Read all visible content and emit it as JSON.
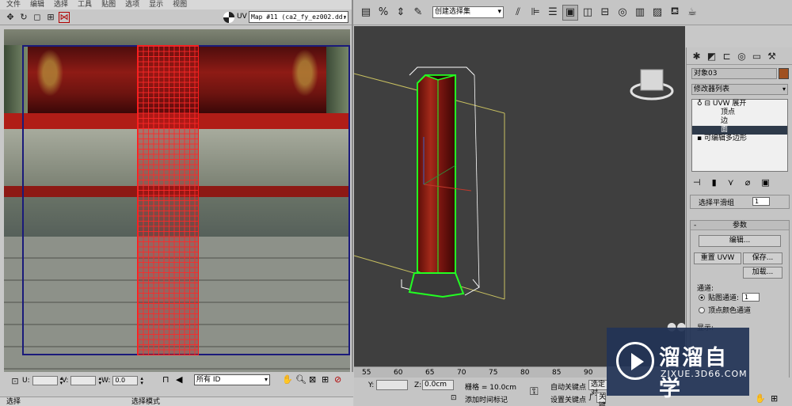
{
  "uv_editor": {
    "menu": [
      "文件",
      "编辑",
      "选择",
      "工具",
      "贴图",
      "选项",
      "显示",
      "视图"
    ],
    "toolbar_icons": [
      "move-icon",
      "rotate-icon",
      "scale-icon",
      "freeform-icon",
      "mirror-icon"
    ],
    "uv_label": "UV",
    "map_select": "Map #11 (ca2_fy_ez002.dd:",
    "coords": [
      {
        "label": "U:",
        "value": ""
      },
      {
        "label": "V:",
        "value": ""
      },
      {
        "label": "W:",
        "value": "0.0"
      }
    ],
    "id_select": "所有 ID",
    "status_left": [
      "选择",
      "选择模式"
    ]
  },
  "main_toolbar": {
    "selection_set": "创建选择集"
  },
  "command_panel": {
    "object_name": "对象03",
    "object_color": "#a05020",
    "modifier_list": "修改器列表",
    "stack": [
      {
        "label": "UVW 展开",
        "level": 0,
        "icon": "lightbulb-icon"
      },
      {
        "label": "顶点",
        "level": 1
      },
      {
        "label": "边",
        "level": 1
      },
      {
        "label": "面",
        "level": 1,
        "selected": true
      },
      {
        "label": "可编辑多边形",
        "level": 0,
        "icon": "square-icon"
      }
    ],
    "rollout_top_label": "选择平滑组",
    "rollout_top_value": "1",
    "params_title": "参数",
    "edit_button": "编辑...",
    "reset_uvw": "重置 UVW",
    "save_button": "保存...",
    "load_button": "加载...",
    "channel_group": "通道:",
    "map_channel": "贴图通道:",
    "map_channel_value": "1",
    "vertex_color_channel": "顶点颜色通道",
    "display_group": "显示:"
  },
  "timeline": {
    "ticks": [
      "55",
      "60",
      "65",
      "70",
      "75",
      "80",
      "85",
      "90"
    ]
  },
  "statusbar": {
    "y_label": "Y:",
    "z_label": "Z:",
    "z_value": "0.0cm",
    "grid": "栅格 = 10.0cm",
    "auto_key": "自动关键点",
    "selected_object": "选定对",
    "set_key": "设置关键点",
    "key_filter": "关键点过滤器...",
    "add_time_tag": "添加时间标记"
  },
  "watermark": {
    "name": "溜溜自学",
    "url": "ZIXUE.3D66.COM"
  }
}
